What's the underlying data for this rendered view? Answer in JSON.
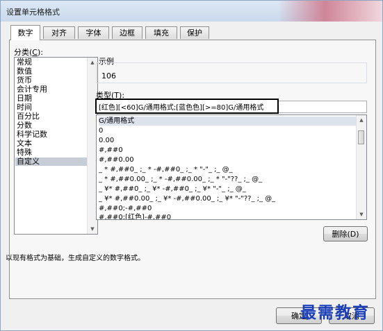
{
  "window": {
    "title": "设置单元格格式"
  },
  "tabs": [
    {
      "label": "数字",
      "active": true
    },
    {
      "label": "对齐",
      "active": false
    },
    {
      "label": "字体",
      "active": false
    },
    {
      "label": "边框",
      "active": false
    },
    {
      "label": "填充",
      "active": false
    },
    {
      "label": "保护",
      "active": false
    }
  ],
  "category": {
    "label": "分类(",
    "hotkey": "C",
    "label_end": "):",
    "items": [
      "常规",
      "数值",
      "货币",
      "会计专用",
      "日期",
      "时间",
      "百分比",
      "分数",
      "科学记数",
      "文本",
      "特殊",
      "自定义"
    ],
    "selected": "自定义"
  },
  "sample": {
    "label": "示例",
    "value": "106"
  },
  "type": {
    "label": "类型(",
    "hotkey": "T",
    "label_end": "):",
    "value": "[红色][<60]G/通用格式;[蓝色色][>=80]G/通用格式"
  },
  "formats": [
    "G/通用格式",
    "0",
    "0.00",
    "#,##0",
    "#,##0.00",
    "_ * #,##0_ ;_ * -#,##0_ ;_ * \"-\"_ ;_ @_",
    "_ * #,##0.00_ ;_ * -#,##0.00_ ;_ * \"-\"??_ ;_ @_",
    "_ ¥* #,##0_ ;_ ¥* -#,##0_ ;_ ¥* \"-\"_ ;_ @_",
    "_ ¥* #,##0.00_ ;_ ¥* -#,##0.00_ ;_ ¥* \"-\"??_ ;_ @_",
    "#,##0;-#,##0",
    "#,##0;[红色]-#,##0"
  ],
  "buttons": {
    "delete": "删除(D)",
    "ok": "确定",
    "cancel": "取消"
  },
  "hint": "以现有格式为基础，生成自定义的数字格式。",
  "watermark": "最需教育",
  "colors": {
    "accent": "#1a3fb8",
    "selection": "#c7cdd6"
  }
}
